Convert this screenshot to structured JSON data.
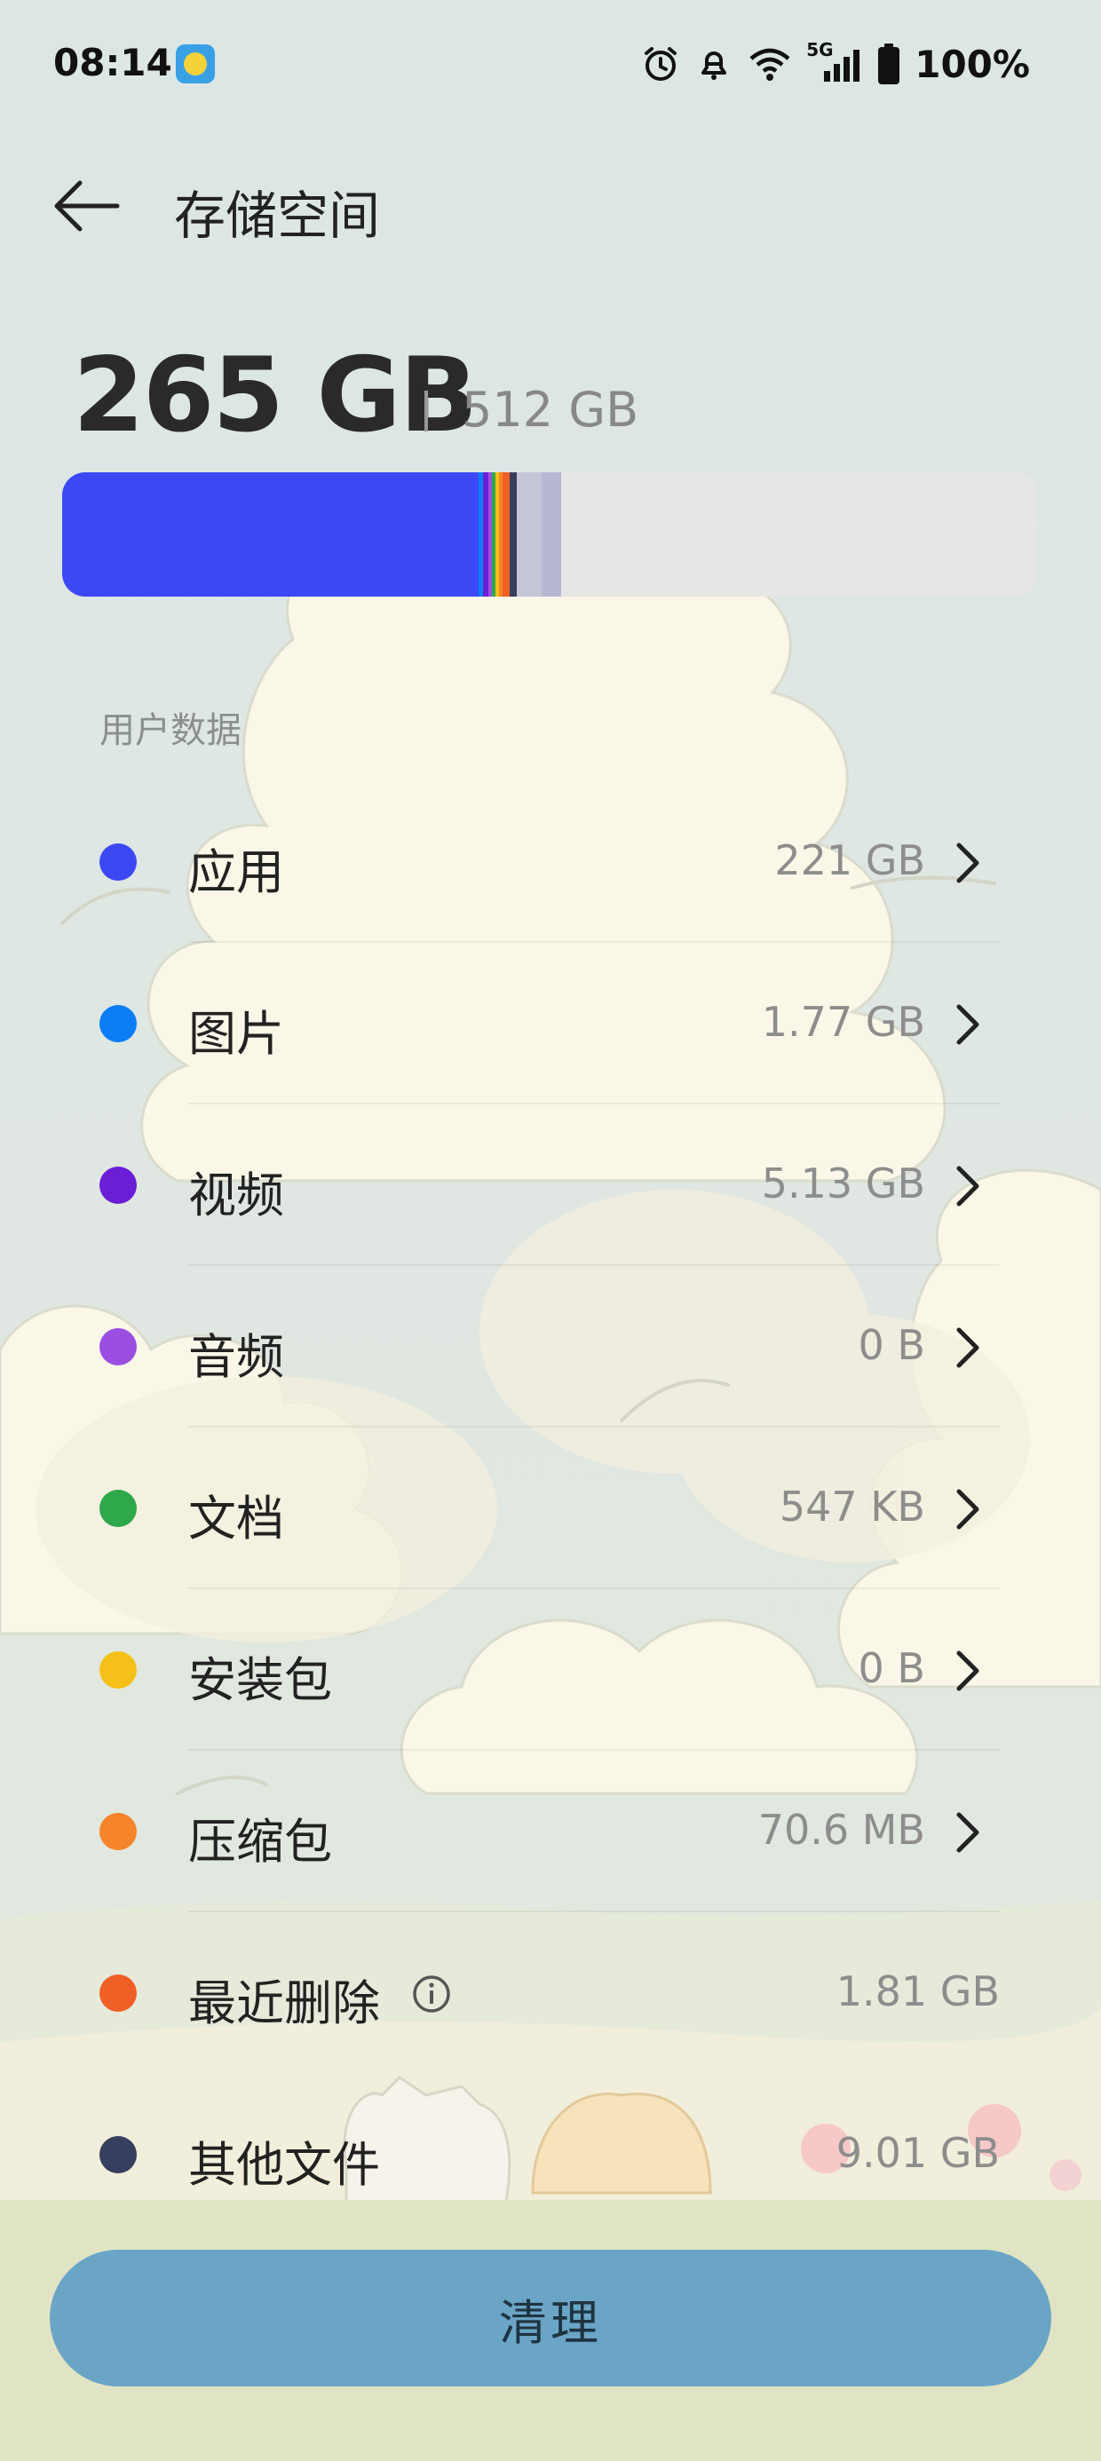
{
  "status_bar": {
    "time": "08:14",
    "network": "5G",
    "battery": "100%"
  },
  "header": {
    "title": "存储空间"
  },
  "summary": {
    "used": "265 GB",
    "total": "512 GB"
  },
  "usage_bar": {
    "colors": [
      "#3d48f5",
      "#0a7df5",
      "#6a1fd6",
      "#9b4fe0",
      "#2ea84a",
      "#f5c01a",
      "#f5842a",
      "#f06026",
      "#373f5e",
      "#b6b8d2"
    ],
    "track_color": "#e6e6e6",
    "used_fraction": 0.5176
  },
  "section_label": "用户数据",
  "categories": [
    {
      "name": "应用",
      "size": "221 GB",
      "color": "#3d48f5"
    },
    {
      "name": "图片",
      "size": "1.77 GB",
      "color": "#0a7df5"
    },
    {
      "name": "视频",
      "size": "5.13 GB",
      "color": "#6a1fd6"
    },
    {
      "name": "音频",
      "size": "0 B",
      "color": "#9b4fe0"
    },
    {
      "name": "文档",
      "size": "547 KB",
      "color": "#2ea84a"
    },
    {
      "name": "安装包",
      "size": "0 B",
      "color": "#f5c01a"
    },
    {
      "name": "压缩包",
      "size": "70.6 MB",
      "color": "#f5842a"
    },
    {
      "name": "最近删除",
      "size": "1.81 GB",
      "color": "#f06026"
    },
    {
      "name": "其他文件",
      "size": "9.01 GB",
      "color": "#373f5e"
    }
  ],
  "actions": {
    "clean_label": "清理"
  },
  "icons": [
    "back-arrow-icon",
    "app-notification-icon",
    "alarm-icon",
    "bell-icon",
    "wifi-icon",
    "cellular-signal-icon",
    "battery-icon",
    "chevron-right-icon",
    "info-icon"
  ]
}
